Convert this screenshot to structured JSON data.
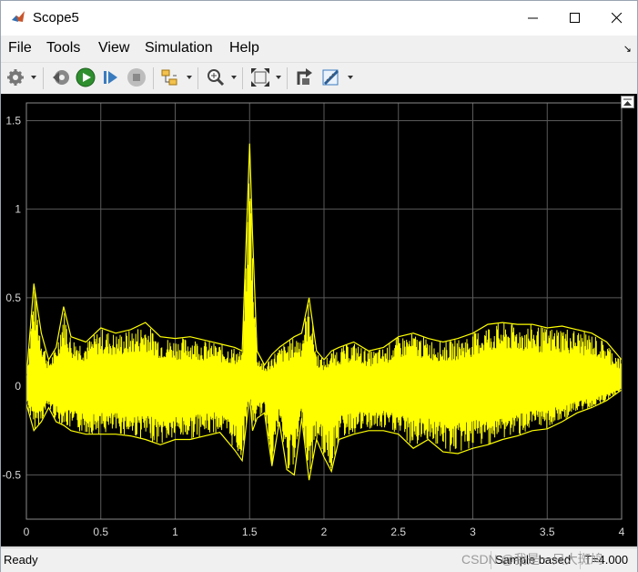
{
  "window": {
    "title": "Scope5",
    "minimize_icon": "minimize-icon",
    "maximize_icon": "maximize-icon",
    "close_icon": "close-icon"
  },
  "menu": {
    "items": [
      {
        "label": "File"
      },
      {
        "label": "Tools"
      },
      {
        "label": "View"
      },
      {
        "label": "Simulation"
      },
      {
        "label": "Help"
      }
    ]
  },
  "toolbar": {
    "icons": [
      "gear-icon",
      "step-back-icon",
      "run-icon",
      "step-forward-icon",
      "stop-icon",
      "signal-select-icon",
      "zoom-icon",
      "autoscale-icon",
      "highlight-icon",
      "measurement-icon"
    ]
  },
  "status": {
    "left": "Ready",
    "mode": "Sample based",
    "time": "T=4.000"
  },
  "watermark": "CSDN @我是一只大斑鸠",
  "colors": {
    "signal": "#ffff00",
    "plot_bg": "#000000",
    "grid": "#5a5a5a",
    "axis_text": "#d8d8d8"
  },
  "chart_data": {
    "type": "line",
    "title": "",
    "xlabel": "",
    "ylabel": "",
    "xlim": [
      0,
      4
    ],
    "ylim": [
      -0.75,
      1.6
    ],
    "xticks": [
      "0",
      "0.5",
      "1",
      "1.5",
      "2",
      "2.5",
      "3",
      "3.5",
      "4"
    ],
    "yticks": [
      "1.5",
      "1",
      "0.5",
      "0",
      "-0.5"
    ],
    "grid": true,
    "series": [
      {
        "color": "#ffff00",
        "envelope_x": [
          0,
          0.05,
          0.1,
          0.15,
          0.2,
          0.25,
          0.3,
          0.4,
          0.5,
          0.6,
          0.7,
          0.8,
          0.9,
          1.0,
          1.1,
          1.2,
          1.3,
          1.4,
          1.45,
          1.5,
          1.52,
          1.55,
          1.6,
          1.65,
          1.7,
          1.75,
          1.8,
          1.85,
          1.9,
          1.95,
          2.0,
          2.05,
          2.1,
          2.2,
          2.3,
          2.4,
          2.5,
          2.6,
          2.7,
          2.8,
          2.9,
          3.0,
          3.1,
          3.2,
          3.3,
          3.4,
          3.5,
          3.6,
          3.7,
          3.8,
          3.9,
          4.0
        ],
        "envelope_max": [
          0.05,
          0.58,
          0.3,
          0.15,
          0.22,
          0.45,
          0.28,
          0.25,
          0.33,
          0.3,
          0.32,
          0.36,
          0.28,
          0.27,
          0.28,
          0.26,
          0.24,
          0.22,
          0.2,
          1.37,
          0.85,
          0.2,
          0.12,
          0.18,
          0.22,
          0.25,
          0.28,
          0.3,
          0.5,
          0.2,
          0.15,
          0.2,
          0.22,
          0.25,
          0.2,
          0.22,
          0.28,
          0.3,
          0.27,
          0.25,
          0.27,
          0.3,
          0.35,
          0.36,
          0.35,
          0.35,
          0.33,
          0.34,
          0.32,
          0.3,
          0.25,
          0.15
        ],
        "envelope_min": [
          -0.1,
          -0.25,
          -0.2,
          -0.12,
          -0.2,
          -0.22,
          -0.25,
          -0.27,
          -0.27,
          -0.27,
          -0.28,
          -0.3,
          -0.33,
          -0.3,
          -0.3,
          -0.28,
          -0.26,
          -0.36,
          -0.42,
          -0.05,
          -0.25,
          -0.18,
          -0.15,
          -0.45,
          -0.2,
          -0.47,
          -0.5,
          -0.18,
          -0.53,
          -0.3,
          -0.4,
          -0.48,
          -0.3,
          -0.27,
          -0.25,
          -0.25,
          -0.27,
          -0.35,
          -0.3,
          -0.37,
          -0.38,
          -0.35,
          -0.33,
          -0.3,
          -0.28,
          -0.25,
          -0.24,
          -0.2,
          -0.15,
          -0.12,
          -0.08,
          -0.02
        ]
      }
    ]
  }
}
